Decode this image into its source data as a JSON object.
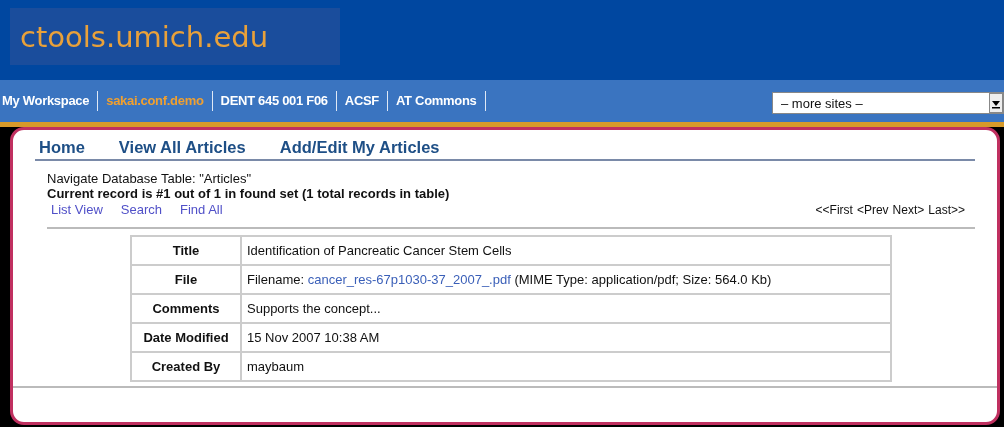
{
  "header": {
    "logo": "ctools.umich.edu"
  },
  "sites": [
    {
      "label": "My Workspace",
      "selected": false
    },
    {
      "label": "sakai.conf.demo",
      "selected": true
    },
    {
      "label": "DENT 645 001 F06",
      "selected": false
    },
    {
      "label": "ACSF",
      "selected": false
    },
    {
      "label": "AT Commons",
      "selected": false
    }
  ],
  "site_select": {
    "value": "– more sites –"
  },
  "tool_menu": [
    "Home",
    "View All Articles",
    "Add/Edit My Articles"
  ],
  "navigation": {
    "heading": "Navigate Database Table: \"Articles\"",
    "status": "Current record is #1 out of 1 in found set (1 total records in table)",
    "links": [
      "List View",
      "Search",
      "Find All"
    ],
    "pager": [
      "<<First",
      "<Prev",
      "Next>",
      "Last>>"
    ]
  },
  "record": [
    {
      "label": "Title",
      "value": "Identification of Pancreatic Cancer Stem Cells"
    },
    {
      "label": "File",
      "prefix": "Filename: ",
      "link": "cancer_res-67p1030-37_2007_.pdf",
      "suffix": " (MIME Type: application/pdf; Size: 564.0 Kb)"
    },
    {
      "label": "Comments",
      "value": "Supports the concept..."
    },
    {
      "label": "Date Modified",
      "value": "15 Nov 2007 10:38 AM"
    },
    {
      "label": "Created By",
      "value": "maybaum"
    }
  ]
}
